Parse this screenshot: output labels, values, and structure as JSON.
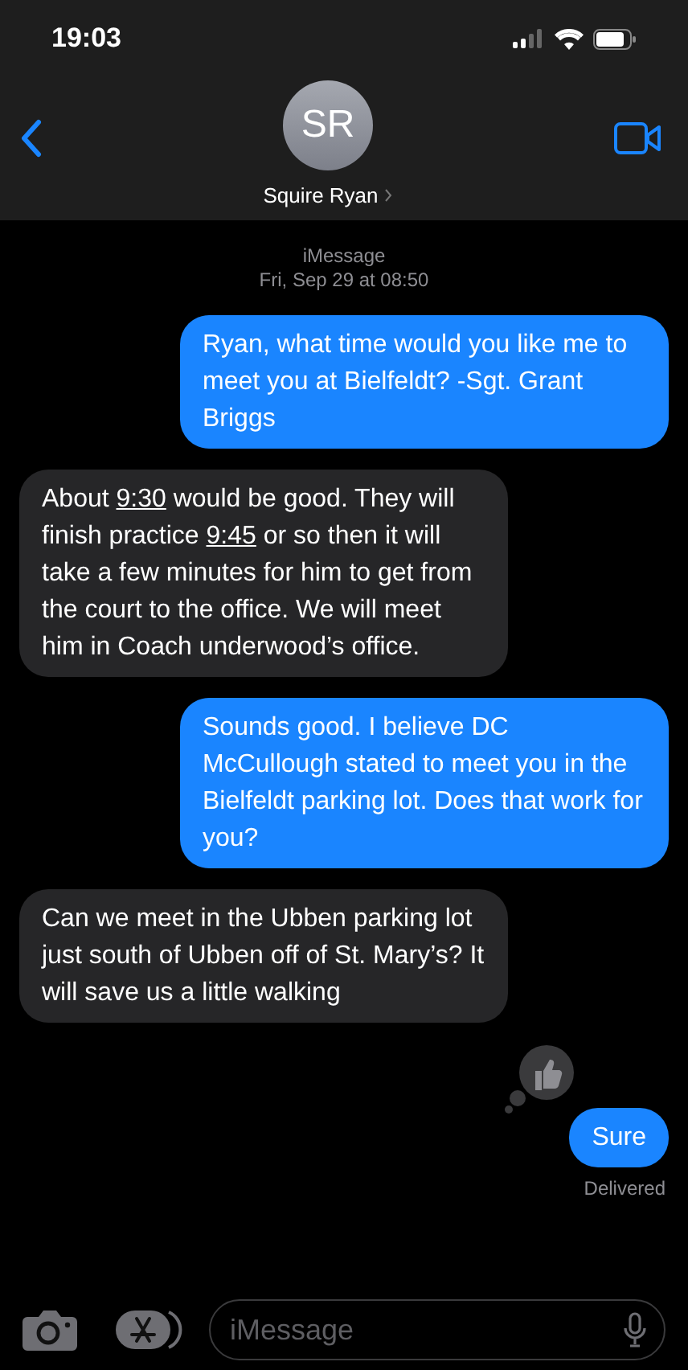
{
  "status_bar": {
    "time": "19:03"
  },
  "header": {
    "initials": "SR",
    "name": "Squire Ryan"
  },
  "thread_header": {
    "service": "iMessage",
    "timestamp": "Fri, Sep 29 at 08:50"
  },
  "messages": [
    {
      "kind": "sent",
      "tapback": false,
      "segments": [
        {
          "kind": "text",
          "text": "Ryan, what time would you like me to meet you at Bielfeldt? -Sgt. Grant Briggs"
        }
      ]
    },
    {
      "kind": "received",
      "tapback": false,
      "segments": [
        {
          "kind": "text",
          "text": "About "
        },
        {
          "kind": "link",
          "text": "9:30"
        },
        {
          "kind": "text",
          "text": " would be good. They will finish practice "
        },
        {
          "kind": "link",
          "text": "9:45"
        },
        {
          "kind": "text",
          "text": " or so then it will take a few minutes for him to get from the court to the office. We will meet him in Coach underwood’s office."
        }
      ]
    },
    {
      "kind": "sent",
      "tapback": false,
      "segments": [
        {
          "kind": "text",
          "text": "Sounds good. I believe DC McCullough stated to meet you in the Bielfeldt parking lot. Does that work for you?"
        }
      ]
    },
    {
      "kind": "received",
      "tapback": false,
      "segments": [
        {
          "kind": "text",
          "text": "Can we meet in the Ubben parking lot just south of Ubben off of St. Mary’s?  It will save us a little walking"
        }
      ]
    },
    {
      "kind": "sent",
      "tapback": true,
      "segments": [
        {
          "kind": "text",
          "text": "Sure"
        }
      ]
    }
  ],
  "delivery_status": "Delivered",
  "composer": {
    "placeholder": "iMessage"
  }
}
